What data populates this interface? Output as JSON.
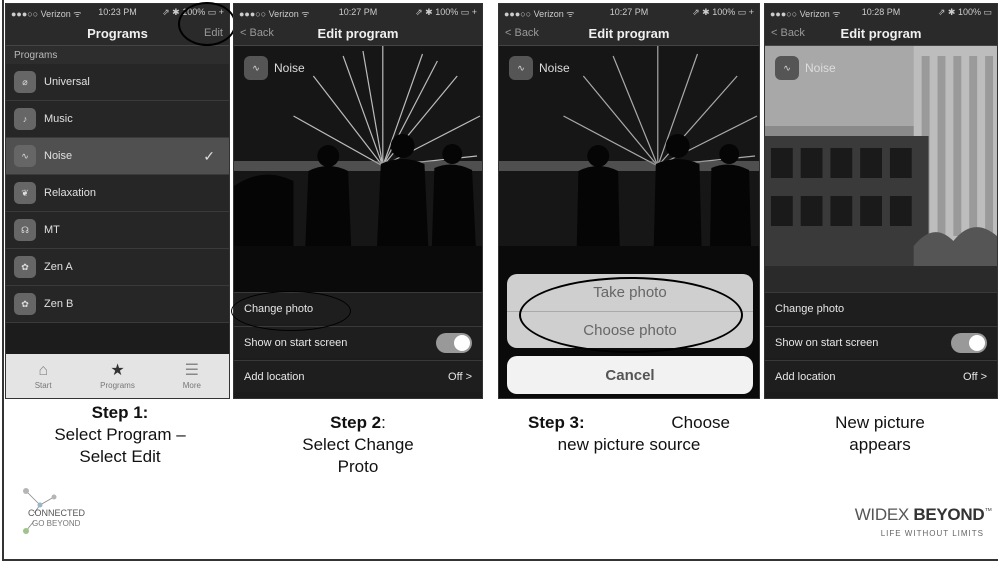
{
  "colors": {
    "screen_bg": "#1c1c1c",
    "tabbar_bg": "#e4e4e4",
    "sheet_bg": "#cfcfcf"
  },
  "phone1": {
    "status": {
      "carrier": "●●●○○ Verizon ᯤ",
      "time": "10:23 PM",
      "battery": "⇗ ✱ 100% ▭ +"
    },
    "title": "Programs",
    "right_action": "Edit",
    "section": "Programs",
    "items": [
      {
        "icon": "universal-icon",
        "label": "Universal",
        "selected": false
      },
      {
        "icon": "music-icon",
        "label": "Music",
        "selected": false
      },
      {
        "icon": "noise-icon",
        "label": "Noise",
        "selected": true
      },
      {
        "icon": "relaxation-icon",
        "label": "Relaxation",
        "selected": false
      },
      {
        "icon": "mt-icon",
        "label": "MT",
        "selected": false
      },
      {
        "icon": "zen-a-icon",
        "label": "Zen A",
        "selected": false
      },
      {
        "icon": "zen-b-icon",
        "label": "Zen B",
        "selected": false
      }
    ],
    "tabs": [
      {
        "icon": "home-icon",
        "label": "Start"
      },
      {
        "icon": "star-icon",
        "label": "Programs"
      },
      {
        "icon": "list-icon",
        "label": "More"
      }
    ]
  },
  "phone2": {
    "status": {
      "carrier": "●●●○○ Verizon ᯤ",
      "time": "10:27 PM",
      "battery": "⇗ ✱ 100% ▭ +"
    },
    "back": "< Back",
    "title": "Edit program",
    "program_name": "Noise",
    "change_photo": "Change photo",
    "show_on_start": "Show on start screen",
    "add_location": "Add location",
    "location_value": "Off >"
  },
  "phone3": {
    "status": {
      "carrier": "●●●○○ Verizon ᯤ",
      "time": "10:27 PM",
      "battery": "⇗ ✱ 100% ▭ +"
    },
    "back": "< Back",
    "title": "Edit program",
    "program_name": "Noise",
    "take_photo": "Take photo",
    "choose_photo": "Choose photo",
    "cancel": "Cancel"
  },
  "phone4": {
    "status": {
      "carrier": "●●●○○ Verizon ᯤ",
      "time": "10:28 PM",
      "battery": "⇗ ✱ 100% ▭"
    },
    "back": "< Back",
    "title": "Edit program",
    "program_name": "Noise",
    "change_photo": "Change photo",
    "show_on_start": "Show on start screen",
    "add_location": "Add location",
    "location_value": "Off >"
  },
  "captions": {
    "step1_bold": "Step 1:",
    "step1_line2": "Select Program –",
    "step1_line3": "Select Edit",
    "step2_bold": "Step 2",
    "step2_colon": ":",
    "step2_line2": "Select Change",
    "step2_line3": "Proto",
    "step3_bold": "Step 3:",
    "step3_rest": "Choose",
    "step3_line2": "new picture source",
    "step4_line1": "New picture",
    "step4_line2": "appears"
  },
  "logos": {
    "left_line1": "CONNECTED",
    "left_line2": "GO BEYOND",
    "brand_a": "WIDEX",
    "brand_b": "BEYOND",
    "tm": "™",
    "tagline": "LIFE WITHOUT LIMITS"
  }
}
